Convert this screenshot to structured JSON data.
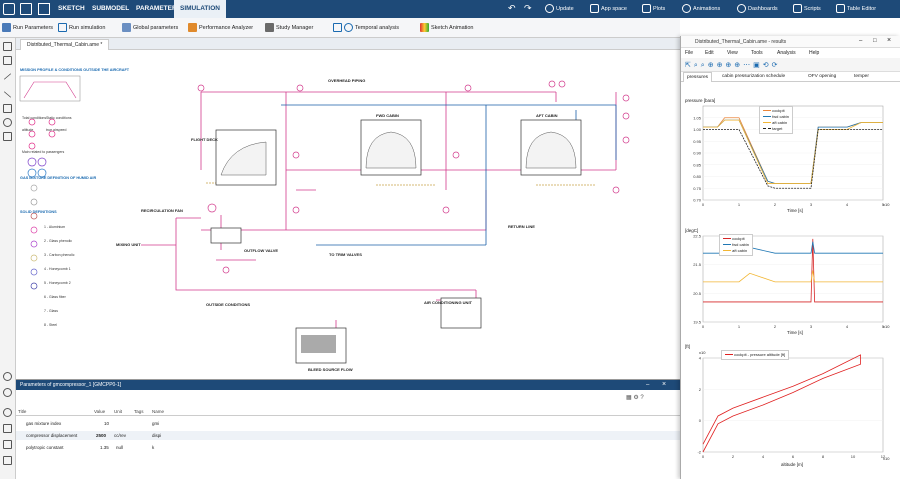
{
  "topbar": {
    "tabs": [
      "SKETCH",
      "SUBMODEL",
      "PARAMETER",
      "SIMULATION"
    ],
    "update": "Update",
    "app_space": "App space",
    "plots": "Plots",
    "animations": "Animations",
    "dashboards": "Dashboards",
    "scripts": "Scripts",
    "table_editor": "Table Editor"
  },
  "toolbar": {
    "run_parameters": "Run Parameters",
    "run_simulation": "Run simulation",
    "global_parameters": "Global parameters",
    "performance_analyzer": "Performance Analyzer",
    "study_manager": "Study Manager",
    "temporal_analysis": "Temporal analysis",
    "sketch_animation": "Sketch Animation"
  },
  "document": {
    "tab": "Distributed_Thermal_Cabin.ame *"
  },
  "sketch": {
    "mission_title": "MISSION PROFILE & CONDITIONS OUTSIDE THE AIRCRAFT",
    "overhead": "OVERHEAD PIPING",
    "fwd_cabin": "FWD CABIN",
    "aft_cabin": "AFT CABIN",
    "flight_deck": "FLIGHT DECK",
    "gas_mixture": "GAS MIXTURE DEFINITION OF HUMID AIR",
    "solid": "SOLID DEFINITIONS",
    "recirc_fan": "RECIRCULATION FAN",
    "mixing_unit": "MIXING UNIT",
    "outflow_valve": "OUTFLOW VALVE",
    "return_line": "RETURN LINE",
    "to_trim": "TO TRIM VALVES",
    "outside_cond": "OUTSIDE CONDITIONS",
    "air_cond_unit": "AIR CONDITIONING UNIT",
    "bleed_source": "BLEED SOURCE FLOW",
    "total_cond": "Total conditions",
    "static_cond": "Static conditions",
    "altitude": "altitude",
    "true_airspeed": "true airspeed",
    "main_related": "Main related to passengers",
    "solids": [
      "1 - Aluminium",
      "2 - Glass phenolic",
      "3 - Carbon phenolic",
      "4 - Honeycomb 1",
      "5 - Honeycomb 2",
      "6 - Glass fiber",
      "7 - Glass",
      "8 - Steel"
    ]
  },
  "params": {
    "title": "Parameters of gmcompressor_1 [GMCPP0-1]",
    "headers": [
      "Title",
      "Value",
      "Unit",
      "Tags",
      "Name"
    ],
    "rows": [
      {
        "title": "gas mixture index",
        "value": "10",
        "unit": "",
        "tags": "",
        "name": "gmi"
      },
      {
        "title": "compressor displacement",
        "value": "2500",
        "unit": "cc/rev",
        "tags": "",
        "name": "dispi"
      },
      {
        "title": "polytropic constant",
        "value": "1.35",
        "unit": "null",
        "tags": "",
        "name": "k"
      }
    ]
  },
  "results": {
    "title": "Distributed_Thermal_Cabin.ame - results",
    "menu": [
      "File",
      "Edit",
      "View",
      "Tools",
      "Analysis",
      "Help"
    ],
    "tabs": [
      "pressures",
      "cabin pressurization schedule",
      "OFV opening",
      "temper"
    ],
    "plot1": {
      "title": "pressure [bara]",
      "xlabel": "Time [s]",
      "xmult": "x10",
      "legend": [
        "cockpit",
        "fwd cabin",
        "aft cabin",
        "target"
      ]
    },
    "plot2": {
      "title": "[degC]",
      "xlabel": "Time [s]",
      "xmult": "x10",
      "legend": [
        "cockpit",
        "fwd cabin",
        "aft cabin"
      ]
    },
    "plot3": {
      "title": "[ft]",
      "ymult": "x10",
      "xlabel": "altitude [m]",
      "xmult": "x10",
      "legend": [
        "cockpit - pressure altitude [ft]"
      ]
    }
  },
  "chart_data": [
    {
      "type": "line",
      "title": "pressure [bara]",
      "xlabel": "Time [s]",
      "ylabel": "pressure [bara]",
      "x": [
        0,
        0.4,
        0.6,
        1.0,
        1.8,
        2.0,
        3.0,
        3.2,
        4.0,
        4.4,
        5.0
      ],
      "xlim": [
        0,
        5
      ],
      "ylim": [
        0.7,
        1.1
      ],
      "ticks_y": [
        "0.70",
        "0.75",
        "0.80",
        "0.85",
        "0.90",
        "0.95",
        "1.00",
        "1.05"
      ],
      "ticks_x": [
        "0",
        "1",
        "2",
        "3",
        "4",
        "5"
      ],
      "series": [
        {
          "name": "cockpit",
          "color": "#e9853a",
          "values": [
            1.01,
            1.01,
            1.05,
            1.05,
            0.78,
            0.77,
            0.77,
            1.01,
            1.01,
            1.03,
            1.03
          ]
        },
        {
          "name": "fwd cabin",
          "color": "#1f77b4",
          "values": [
            1.01,
            1.01,
            1.04,
            1.04,
            0.78,
            0.77,
            0.77,
            1.01,
            1.01,
            1.03,
            1.03
          ]
        },
        {
          "name": "aft cabin",
          "color": "#f2b634",
          "values": [
            1.01,
            1.01,
            1.04,
            1.04,
            0.77,
            0.77,
            0.77,
            1.0,
            1.0,
            1.03,
            1.03
          ]
        },
        {
          "name": "target",
          "color": "#222",
          "dashed": true,
          "values": [
            1.0,
            1.0,
            1.0,
            1.0,
            0.76,
            0.75,
            0.75,
            1.0,
            1.0,
            1.0,
            1.0
          ]
        }
      ]
    },
    {
      "type": "line",
      "title": "[degC]",
      "xlabel": "Time [s]",
      "x": [
        0,
        0.5,
        1.0,
        1.3,
        2.0,
        3.0,
        3.05,
        3.1,
        3.2,
        4.0,
        5.0
      ],
      "xlim": [
        0,
        5
      ],
      "ylim": [
        19.5,
        22.5
      ],
      "ticks_y": [
        "19.5",
        "20.5",
        "21.5",
        "22.5"
      ],
      "ticks_x": [
        "0",
        "1",
        "2",
        "3",
        "4",
        "5"
      ],
      "series": [
        {
          "name": "cockpit",
          "color": "#d62728",
          "values": [
            20.2,
            20.2,
            20.2,
            20.2,
            20.2,
            20.2,
            22.4,
            20.2,
            20.2,
            20.2,
            20.2
          ]
        },
        {
          "name": "fwd cabin",
          "color": "#1f77b4",
          "values": [
            21.9,
            21.9,
            21.9,
            22.1,
            21.9,
            21.9,
            22.3,
            21.9,
            21.9,
            21.9,
            21.9
          ]
        },
        {
          "name": "aft cabin",
          "color": "#f2b634",
          "values": [
            20.9,
            20.9,
            20.9,
            21.2,
            20.9,
            20.9,
            21.3,
            20.9,
            20.9,
            20.9,
            20.9
          ]
        }
      ]
    },
    {
      "type": "line",
      "title": "[ft]",
      "xlabel": "altitude [m]",
      "x": [
        0,
        1,
        2,
        4,
        6,
        8,
        10.5,
        10.5,
        8,
        6,
        4,
        2,
        1,
        0
      ],
      "xlim": [
        0,
        12
      ],
      "ylim": [
        -2,
        4
      ],
      "ticks_y": [
        "-2",
        "0",
        "2",
        "4"
      ],
      "ticks_x": [
        "0",
        "2",
        "4",
        "6",
        "8",
        "10",
        "12"
      ],
      "series": [
        {
          "name": "cockpit - pressure altitude [ft]",
          "color": "#e02020",
          "values": [
            -2,
            -0.2,
            0.3,
            1.0,
            1.8,
            2.7,
            3.6,
            4.2,
            3.0,
            2.2,
            1.5,
            0.8,
            0.3,
            -1.5
          ]
        }
      ]
    }
  ]
}
